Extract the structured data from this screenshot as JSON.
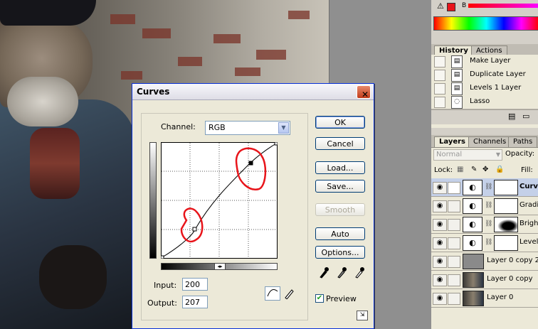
{
  "curves_dialog": {
    "title": "Curves",
    "channel_label": "Channel:",
    "channel_value": "RGB",
    "buttons": {
      "ok": "OK",
      "cancel": "Cancel",
      "load": "Load...",
      "save": "Save...",
      "smooth": "Smooth",
      "auto": "Auto",
      "options": "Options..."
    },
    "input_label": "Input:",
    "input_value": "200",
    "output_label": "Output:",
    "output_value": "207",
    "preview_label": "Preview",
    "preview_checked": true
  },
  "history_panel": {
    "tabs": [
      "History",
      "Actions"
    ],
    "items": [
      "Make Layer",
      "Duplicate Layer",
      "Levels 1 Layer",
      "Lasso"
    ]
  },
  "layers_panel": {
    "tabs": [
      "Layers",
      "Channels",
      "Paths"
    ],
    "blend_mode": "Normal",
    "opacity_label": "Opacity:",
    "lock_label": "Lock:",
    "fill_label": "Fill:",
    "layers": [
      "Curv...",
      "Gradie",
      "Bright",
      "Levels",
      "Layer 0 copy 2",
      "Layer 0 copy",
      "Layer 0"
    ]
  },
  "color_panel": {
    "slider_label": "B"
  },
  "colors": {
    "annotation_red": "#e8141a",
    "dialog_bg": "#ece9d8",
    "title_blue": "#0831d9"
  }
}
